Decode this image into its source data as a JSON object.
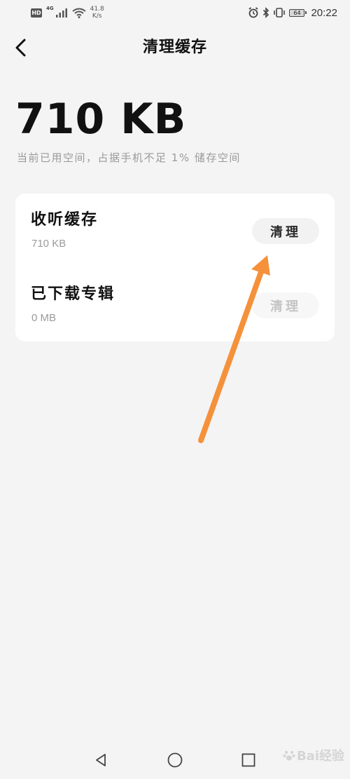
{
  "status_bar": {
    "badge": "HD",
    "network_type": "4G",
    "speed_value": "41.8",
    "speed_unit": "K/s",
    "battery_level": "64",
    "time": "20:22",
    "icons": [
      "hd-icon",
      "signal-icon",
      "wifi-icon",
      "alarm-icon",
      "bluetooth-icon",
      "vibrate-icon",
      "battery-icon"
    ]
  },
  "header": {
    "title": "清理缓存",
    "back_icon": "chevron-left-icon"
  },
  "summary": {
    "total_size": "710 KB",
    "note": "当前已用空间，占据手机不足 1% 储存空间"
  },
  "cache_list": [
    {
      "title": "收听缓存",
      "size": "710 KB",
      "button_label": "清理",
      "enabled": true
    },
    {
      "title": "已下载专辑",
      "size": "0 MB",
      "button_label": "清理",
      "enabled": false
    }
  ],
  "annotation": {
    "arrow_color": "#f5913a",
    "arrow_icon": "annotation-arrow-icon"
  },
  "nav_bar": {
    "icons": [
      "back-triangle-icon",
      "home-circle-icon",
      "recents-square-icon"
    ]
  },
  "watermark": {
    "text": "Bai经验"
  }
}
